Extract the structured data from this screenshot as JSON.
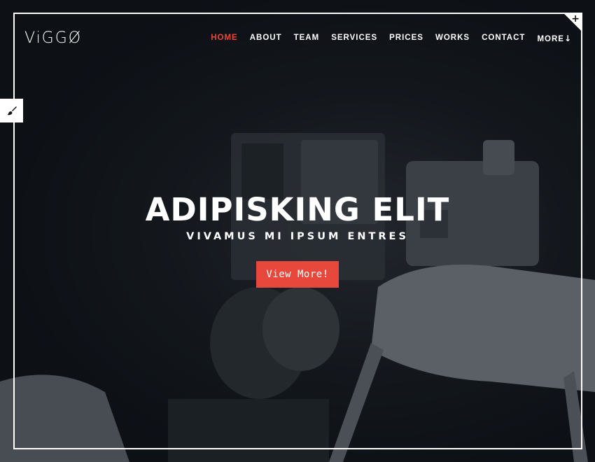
{
  "brand": {
    "logo": "ViGGØ"
  },
  "nav": {
    "items": [
      {
        "label": "HOME",
        "active": true
      },
      {
        "label": "ABOUT"
      },
      {
        "label": "TEAM"
      },
      {
        "label": "SERVICES"
      },
      {
        "label": "PRICES"
      },
      {
        "label": "WORKS"
      },
      {
        "label": "CONTACT"
      },
      {
        "label": "MORE"
      }
    ],
    "more_icon": "arrow-down-icon"
  },
  "hero": {
    "title": "ADIPISKING ELIT",
    "subtitle": "VIVAMUS MI IPSUM ENTRES",
    "cta_label": "View More!"
  },
  "widgets": {
    "corner_symbol": "+",
    "corner_icon": "plus-icon",
    "side_icon": "paintbrush-icon"
  },
  "colors": {
    "accent": "#e8473b",
    "text": "#ffffff",
    "background": "#0d1217"
  }
}
